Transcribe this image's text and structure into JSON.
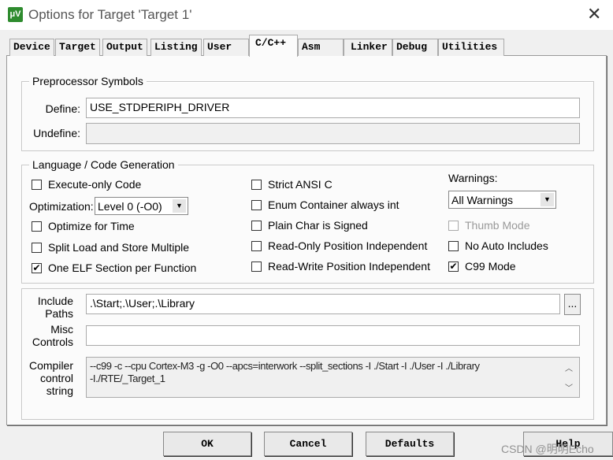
{
  "window": {
    "title": "Options for Target 'Target 1'",
    "icon": "keil-uvision-icon",
    "close": "✕"
  },
  "tabs": [
    {
      "label": "Device"
    },
    {
      "label": "Target"
    },
    {
      "label": "Output"
    },
    {
      "label": "Listing"
    },
    {
      "label": "User"
    },
    {
      "label": "C/C++",
      "active": true
    },
    {
      "label": "Asm"
    },
    {
      "label": "Linker"
    },
    {
      "label": "Debug"
    },
    {
      "label": "Utilities"
    }
  ],
  "preprocessor": {
    "title": "Preprocessor Symbols",
    "define_label": "Define:",
    "define_value": "USE_STDPERIPH_DRIVER",
    "undefine_label": "Undefine:",
    "undefine_value": ""
  },
  "codegen": {
    "title": "Language / Code Generation",
    "execute_only": {
      "label": "Execute-only Code",
      "checked": false
    },
    "optimization_label": "Optimization:",
    "optimization_value": "Level 0 (-O0)",
    "optimize_time": {
      "label": "Optimize for Time",
      "checked": false
    },
    "split_load": {
      "label": "Split Load and Store Multiple",
      "checked": false
    },
    "one_elf": {
      "label": "One ELF Section per Function",
      "checked": true
    },
    "strict_ansi": {
      "label": "Strict ANSI C",
      "checked": false
    },
    "enum_int": {
      "label": "Enum Container always int",
      "checked": false
    },
    "plain_char": {
      "label": "Plain Char is Signed",
      "checked": false
    },
    "ropi": {
      "label": "Read-Only Position Independent",
      "checked": false
    },
    "rwpi": {
      "label": "Read-Write Position Independent",
      "checked": false
    },
    "warnings_label": "Warnings:",
    "warnings_value": "All Warnings",
    "thumb": {
      "label": "Thumb Mode",
      "checked": false,
      "disabled": true
    },
    "no_auto": {
      "label": "No Auto Includes",
      "checked": false
    },
    "c99": {
      "label": "C99 Mode",
      "checked": true
    }
  },
  "include": {
    "label1": "Include",
    "label2": "Paths",
    "value": ".\\Start;.\\User;.\\Library",
    "browse": "..."
  },
  "misc": {
    "label1": "Misc",
    "label2": "Controls",
    "value": ""
  },
  "compiler": {
    "label1": "Compiler",
    "label2": "control",
    "label3": "string",
    "line1": "--c99 -c --cpu Cortex-M3 -g -O0 --apcs=interwork --split_sections -I ./Start -I ./User -I ./Library",
    "line2": "-I./RTE/_Target_1"
  },
  "buttons": {
    "ok": "OK",
    "cancel": "Cancel",
    "defaults": "Defaults",
    "help": "Help"
  },
  "watermark": "CSDN @明明Echo",
  "check": "✔"
}
